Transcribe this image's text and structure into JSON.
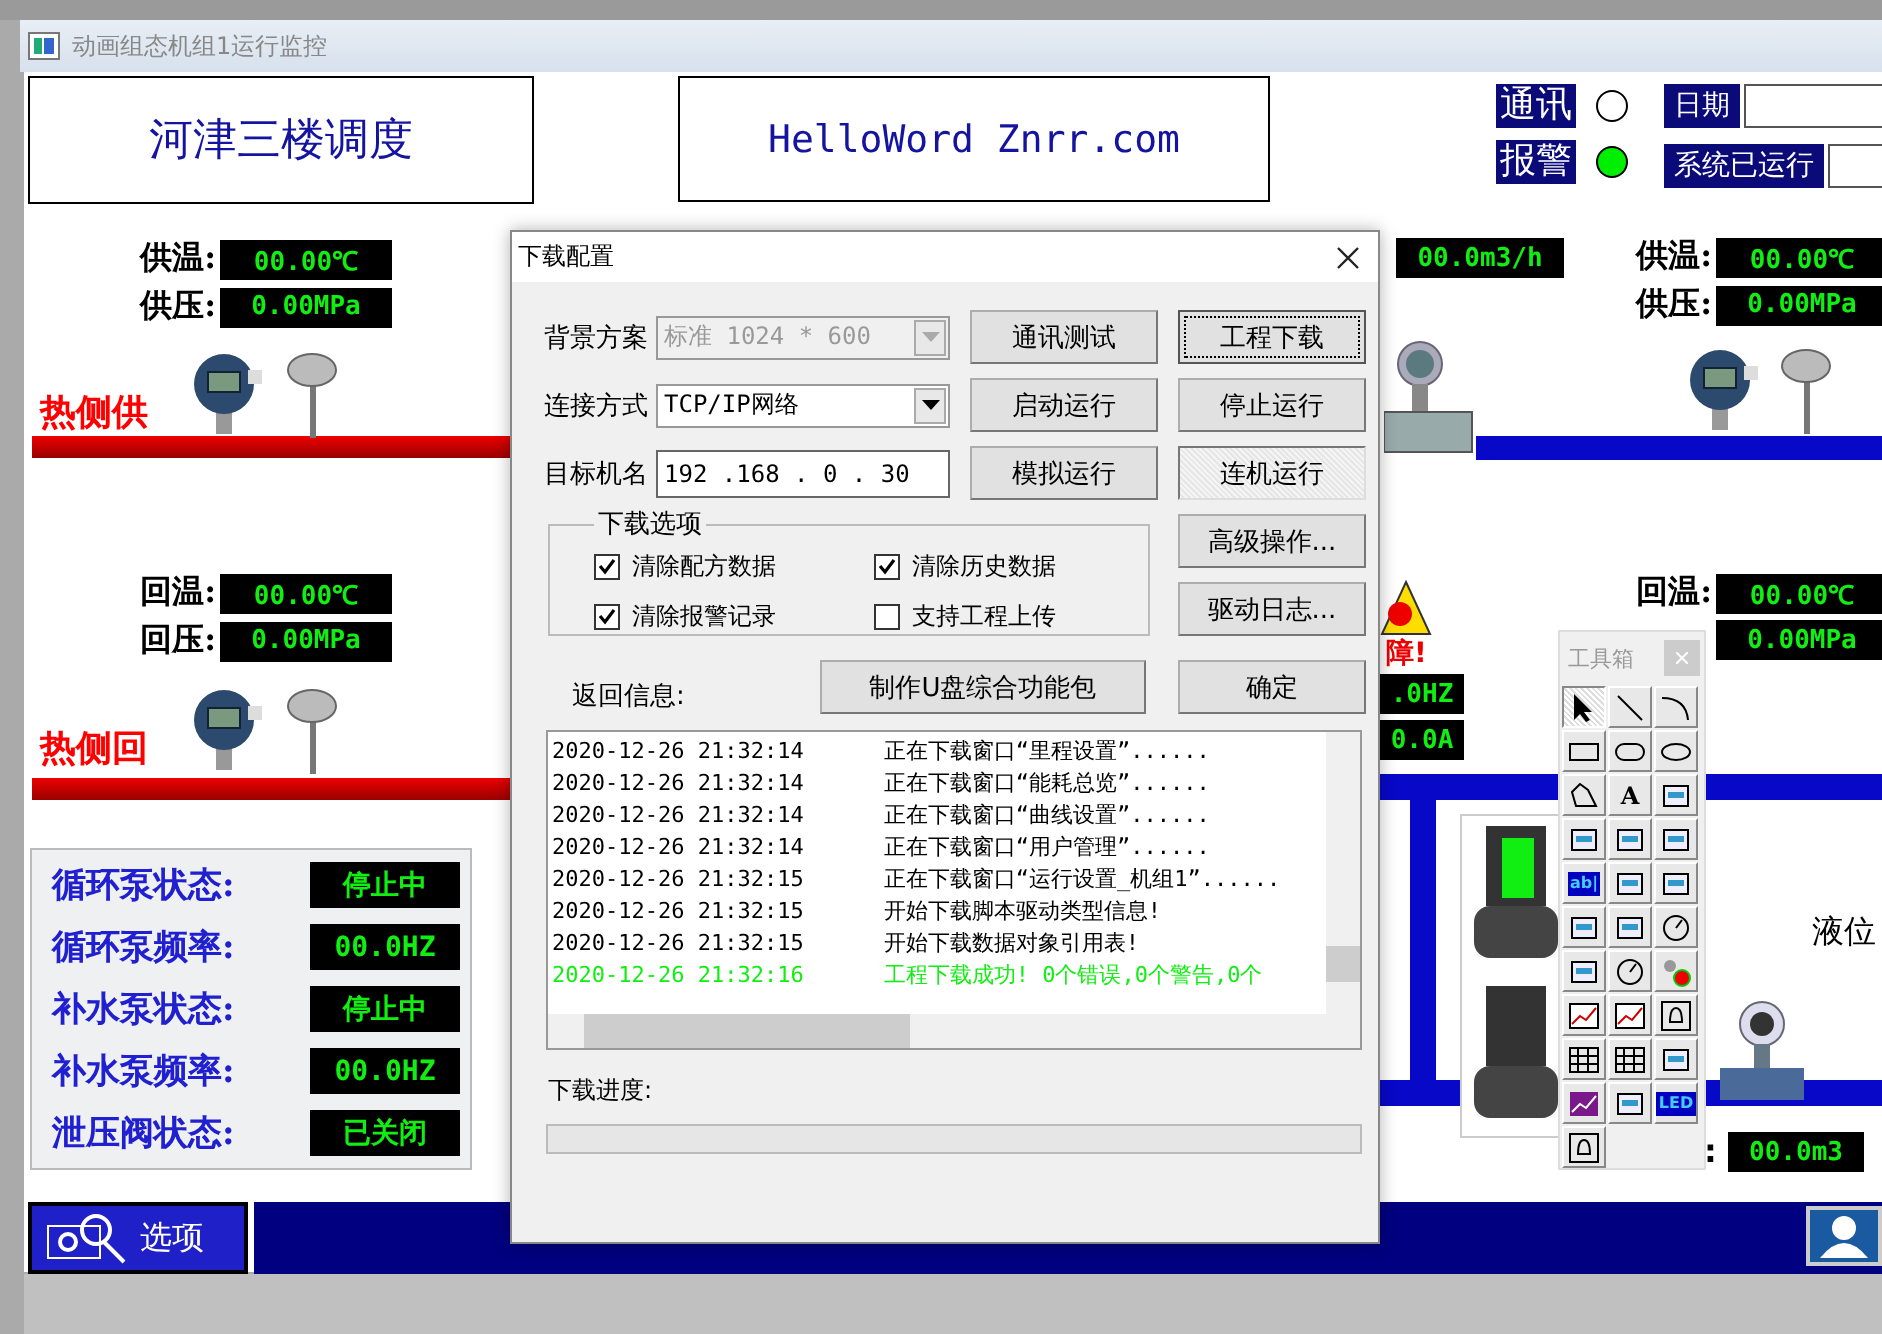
{
  "window": {
    "title": "动画组态机组1运行监控"
  },
  "header": {
    "title": "河津三楼调度",
    "site": "HelloWord Znrr.com"
  },
  "indicators": [
    {
      "label": "通讯",
      "on": false
    },
    {
      "label": "报警",
      "on": true
    }
  ],
  "info_fields": [
    {
      "label": "日期"
    },
    {
      "label": "系统已运行"
    }
  ],
  "left_supply": {
    "readings": [
      {
        "label": "供温:",
        "value": "00.00℃"
      },
      {
        "label": "供压:",
        "value": "0.00MPa"
      }
    ],
    "pipe_label": "热侧供"
  },
  "left_return": {
    "readings": [
      {
        "label": "回温:",
        "value": "00.00℃"
      },
      {
        "label": "回压:",
        "value": "0.00MPa"
      }
    ],
    "pipe_label": "热侧回"
  },
  "flow_reading": "00.0m3/h",
  "right_supply": {
    "readings": [
      {
        "label": "供温:",
        "value": "00.00℃"
      },
      {
        "label": "供压:",
        "value": "0.00MPa"
      }
    ]
  },
  "right_return": {
    "readings": [
      {
        "label": "回温:",
        "value": "00.00℃"
      },
      {
        "value": "0.00MPa"
      }
    ]
  },
  "partial": {
    "alarm": "障!",
    "frequency": ".0HZ",
    "current": "0.0A",
    "level_label": "液位",
    "level_colon": ":",
    "level_value": "00.0m3"
  },
  "status_panel": [
    {
      "label": "循环泵状态:",
      "value": "停止中"
    },
    {
      "label": "循环泵频率:",
      "value": "00.0HZ"
    },
    {
      "label": "补水泵状态:",
      "value": "停止中"
    },
    {
      "label": "补水泵频率:",
      "value": "00.0HZ"
    },
    {
      "label": "泄压阀状态:",
      "value": "已关闭"
    }
  ],
  "options_button": "选项",
  "dialog": {
    "title": "下载配置",
    "fields": [
      {
        "label": "背景方案",
        "value": "标准 1024 * 600",
        "kind": "combo",
        "disabled": true
      },
      {
        "label": "连接方式",
        "value": "TCP/IP网络",
        "kind": "combo",
        "disabled": false
      },
      {
        "label": "目标机名",
        "value": "192 .168 . 0 . 30",
        "kind": "ip",
        "disabled": false
      }
    ],
    "buttons": [
      {
        "label": "通讯测试",
        "focused": false,
        "pressed": false
      },
      {
        "label": "工程下载",
        "focused": true,
        "pressed": false
      },
      {
        "label": "启动运行",
        "focused": false,
        "pressed": false
      },
      {
        "label": "停止运行",
        "focused": false,
        "pressed": false
      },
      {
        "label": "模拟运行",
        "focused": false,
        "pressed": false
      },
      {
        "label": "连机运行",
        "focused": false,
        "pressed": true
      }
    ],
    "group": {
      "title": "下载选项",
      "options": [
        {
          "label": "清除配方数据",
          "checked": true
        },
        {
          "label": "清除历史数据",
          "checked": true
        },
        {
          "label": "清除报警记录",
          "checked": true
        },
        {
          "label": "支持工程上传",
          "checked": false
        }
      ]
    },
    "side_buttons": [
      "高级操作...",
      "驱动日志..."
    ],
    "log_label": "返回信息:",
    "package_button": "制作U盘综合功能包",
    "ok_button": "确定",
    "log": [
      {
        "time": "2020-12-26 21:32:14",
        "message": "正在下载窗口“里程设置”......",
        "kind": "info"
      },
      {
        "time": "2020-12-26 21:32:14",
        "message": "正在下载窗口“能耗总览”......",
        "kind": "info"
      },
      {
        "time": "2020-12-26 21:32:14",
        "message": "正在下载窗口“曲线设置”......",
        "kind": "info"
      },
      {
        "time": "2020-12-26 21:32:14",
        "message": "正在下载窗口“用户管理”......",
        "kind": "info"
      },
      {
        "time": "2020-12-26 21:32:15",
        "message": "正在下载窗口“运行设置_机组1”......",
        "kind": "info"
      },
      {
        "time": "2020-12-26 21:32:15",
        "message": "开始下载脚本驱动类型信息!",
        "kind": "info"
      },
      {
        "time": "2020-12-26 21:32:15",
        "message": "开始下载数据对象引用表!",
        "kind": "info"
      },
      {
        "time": "2020-12-26 21:32:16",
        "message": "工程下载成功! 0个错误,0个警告,0个",
        "kind": "success"
      }
    ],
    "progress_label": "下载进度:",
    "progress": {
      "level": 0
    }
  },
  "toolbox": {
    "title": "工具箱",
    "tools": [
      {
        "kind": "pointer",
        "selected": true
      },
      {
        "kind": "line",
        "selected": false
      },
      {
        "kind": "arc",
        "selected": false
      },
      {
        "kind": "rect",
        "selected": false
      },
      {
        "kind": "roundrect",
        "selected": false
      },
      {
        "kind": "ellipse",
        "selected": false
      },
      {
        "kind": "polygon",
        "selected": false
      },
      {
        "kind": "text",
        "label": "A",
        "selected": false
      },
      {
        "kind": "picture",
        "selected": false
      },
      {
        "kind": "input",
        "selected": false
      },
      {
        "kind": "output",
        "selected": false
      },
      {
        "kind": "popup",
        "selected": false
      },
      {
        "kind": "text",
        "label": "ab|",
        "selected": false
      },
      {
        "kind": "slider",
        "selected": false
      },
      {
        "kind": "bar",
        "selected": false
      },
      {
        "kind": "pipe",
        "selected": false
      },
      {
        "kind": "step",
        "selected": false
      },
      {
        "kind": "dial",
        "selected": false
      },
      {
        "kind": "valve",
        "selected": false
      },
      {
        "kind": "gauge",
        "selected": false
      },
      {
        "kind": "lamp",
        "selected": false
      },
      {
        "kind": "trend",
        "selected": false
      },
      {
        "kind": "trend",
        "selected": false
      },
      {
        "kind": "bell",
        "selected": false
      },
      {
        "kind": "grid",
        "selected": false
      },
      {
        "kind": "grid",
        "selected": false
      },
      {
        "kind": "stack",
        "selected": false
      },
      {
        "kind": "chart",
        "selected": false
      },
      {
        "kind": "form",
        "selected": false
      },
      {
        "kind": "text",
        "label": "LED",
        "selected": false
      },
      {
        "kind": "bell",
        "selected": false
      }
    ]
  }
}
